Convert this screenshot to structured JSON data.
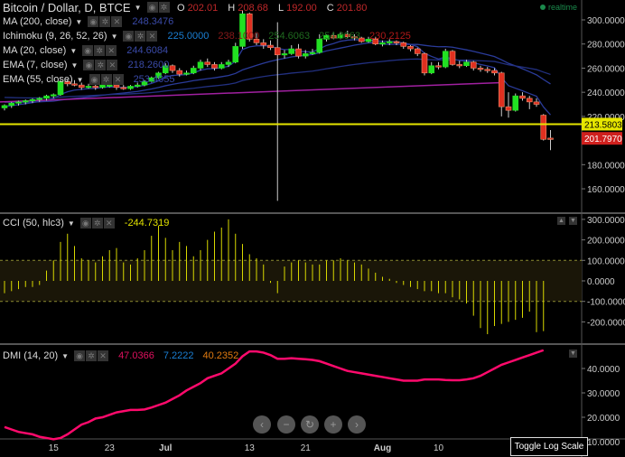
{
  "header": {
    "title": "Bitcoin / Dollar, D, BTCE",
    "ohlc": {
      "o_label": "O",
      "o": "202.01",
      "h_label": "H",
      "h": "208.68",
      "l_label": "L",
      "l": "192.00",
      "c_label": "C",
      "c": "201.80"
    },
    "realtime": "realtime"
  },
  "indicators": [
    {
      "name": "MA (200, close)",
      "values": [
        "248.3476"
      ],
      "colors": [
        "#3a4aa8"
      ]
    },
    {
      "name": "Ichimoku (9, 26, 52, 26)",
      "values": [
        "225.0000",
        "238.1000",
        "254.6063",
        "254.6063",
        "230.2125"
      ],
      "colors": [
        "#1a7fd4",
        "#8b1a1a",
        "#1f6b1f",
        "#1f6b1f",
        "#b01818"
      ]
    },
    {
      "name": "MA (20, close)",
      "values": [
        "244.6084"
      ],
      "colors": [
        "#3a4aa8"
      ]
    },
    {
      "name": "EMA (7, close)",
      "values": [
        "218.2600"
      ],
      "colors": [
        "#3a4aa8"
      ]
    },
    {
      "name": "EMA (55, close)",
      "values": [
        "253.4055"
      ],
      "colors": [
        "#3a4aa8"
      ]
    }
  ],
  "cci": {
    "name": "CCI (50, hlc3)",
    "value": "-244.7319",
    "color": "#e0e000"
  },
  "dmi": {
    "name": "DMI (14, 20)",
    "values": [
      "47.0366",
      "7.2222",
      "40.2352"
    ],
    "colors": [
      "#e0105f",
      "#1a7fd4",
      "#e07a10"
    ]
  },
  "price_labels": {
    "last_line": "213.5803",
    "last_price": "201.7970",
    "line_color": "#e6e600",
    "price_color": "#d0201e"
  },
  "toolbar": {
    "tooltip": "Toggle Log Scale",
    "buttons": [
      "scroll-left",
      "zoom-out",
      "reset",
      "zoom-in",
      "scroll-right"
    ],
    "glyphs": [
      "‹",
      "−",
      "↻",
      "+",
      "›"
    ]
  },
  "chart_data": [
    {
      "type": "candlestick",
      "title": "Bitcoin / Dollar, D, BTCE",
      "yaxis_ticks": [
        "300.0000",
        "280.0000",
        "260.0000",
        "240.0000",
        "220.0000",
        "180.0000",
        "160.0000"
      ],
      "ylim": [
        150,
        310
      ],
      "xaxis_ticks": [
        "15",
        "23",
        "Jul",
        "13",
        "21",
        "Aug",
        "10"
      ],
      "xaxis_tick_index": [
        7,
        15,
        23,
        35,
        43,
        54,
        62
      ],
      "ma200": [
        232,
        248
      ],
      "candles": [
        [
          227,
          230,
          225,
          229
        ],
        [
          229,
          232,
          227,
          231
        ],
        [
          231,
          233,
          229,
          232
        ],
        [
          232,
          234,
          230,
          233
        ],
        [
          233,
          235,
          231,
          234
        ],
        [
          234,
          236,
          232,
          235
        ],
        [
          235,
          238,
          233,
          237
        ],
        [
          237,
          239,
          235,
          238
        ],
        [
          238,
          250,
          237,
          249
        ],
        [
          249,
          251,
          245,
          247
        ],
        [
          247,
          250,
          245,
          246
        ],
        [
          246,
          248,
          242,
          244
        ],
        [
          244,
          247,
          243,
          245
        ],
        [
          245,
          247,
          242,
          244
        ],
        [
          244,
          247,
          243,
          246
        ],
        [
          246,
          248,
          244,
          246
        ],
        [
          246,
          247,
          242,
          244
        ],
        [
          244,
          246,
          242,
          243
        ],
        [
          243,
          246,
          242,
          245
        ],
        [
          245,
          248,
          244,
          246
        ],
        [
          246,
          250,
          245,
          249
        ],
        [
          249,
          253,
          248,
          252
        ],
        [
          252,
          257,
          251,
          256
        ],
        [
          256,
          264,
          255,
          262
        ],
        [
          262,
          263,
          256,
          258
        ],
        [
          258,
          260,
          253,
          255
        ],
        [
          255,
          258,
          254,
          256
        ],
        [
          256,
          262,
          255,
          260
        ],
        [
          260,
          267,
          258,
          265
        ],
        [
          265,
          268,
          261,
          263
        ],
        [
          263,
          265,
          258,
          260
        ],
        [
          260,
          265,
          259,
          263
        ],
        [
          263,
          267,
          261,
          265
        ],
        [
          265,
          281,
          264,
          278
        ],
        [
          278,
          308,
          276,
          305
        ],
        [
          305,
          306,
          282,
          284
        ],
        [
          284,
          289,
          279,
          281
        ],
        [
          281,
          284,
          276,
          279
        ],
        [
          279,
          283,
          275,
          277
        ],
        [
          277,
          298,
          150,
          271
        ],
        [
          271,
          275,
          268,
          272
        ],
        [
          272,
          279,
          271,
          276
        ],
        [
          276,
          280,
          268,
          270
        ],
        [
          270,
          275,
          268,
          272
        ],
        [
          272,
          276,
          271,
          273
        ],
        [
          273,
          288,
          272,
          284
        ],
        [
          284,
          288,
          282,
          287
        ],
        [
          287,
          290,
          284,
          285
        ],
        [
          285,
          290,
          284,
          288
        ],
        [
          288,
          291,
          285,
          286
        ],
        [
          286,
          288,
          283,
          285
        ],
        [
          285,
          286,
          281,
          282
        ],
        [
          282,
          286,
          281,
          284
        ],
        [
          284,
          286,
          279,
          280
        ],
        [
          280,
          283,
          278,
          281
        ],
        [
          281,
          284,
          279,
          282
        ],
        [
          282,
          283,
          279,
          281
        ],
        [
          281,
          282,
          276,
          278
        ],
        [
          278,
          279,
          274,
          276
        ],
        [
          276,
          277,
          270,
          272
        ],
        [
          272,
          273,
          254,
          256
        ],
        [
          256,
          265,
          255,
          262
        ],
        [
          262,
          265,
          259,
          261
        ],
        [
          261,
          276,
          260,
          274
        ],
        [
          274,
          275,
          262,
          263
        ],
        [
          263,
          266,
          260,
          262
        ],
        [
          262,
          267,
          261,
          265
        ],
        [
          265,
          266,
          258,
          260
        ],
        [
          260,
          262,
          257,
          259
        ],
        [
          259,
          261,
          256,
          258
        ],
        [
          258,
          260,
          254,
          256
        ],
        [
          256,
          257,
          220,
          228
        ],
        [
          228,
          240,
          219,
          225
        ],
        [
          225,
          239,
          224,
          237
        ],
        [
          237,
          240,
          233,
          235
        ],
        [
          235,
          237,
          226,
          232
        ],
        [
          232,
          235,
          228,
          230
        ],
        [
          221,
          222,
          200,
          201
        ],
        [
          202.01,
          208.68,
          192.0,
          201.8
        ]
      ]
    },
    {
      "type": "bar",
      "title": "CCI (50, hlc3)",
      "yaxis_ticks": [
        "300.0000",
        "200.0000",
        "100.0000",
        "0.0000",
        "-100.0000",
        "-200.0000"
      ],
      "ylim": [
        -300,
        310
      ],
      "bands": [
        100,
        -100
      ],
      "values": [
        -60,
        -50,
        -40,
        -30,
        -30,
        -20,
        50,
        100,
        190,
        230,
        170,
        110,
        100,
        90,
        120,
        150,
        160,
        90,
        80,
        110,
        150,
        220,
        270,
        210,
        150,
        190,
        170,
        120,
        150,
        200,
        240,
        260,
        300,
        230,
        180,
        130,
        110,
        80,
        -10,
        -60,
        70,
        90,
        100,
        90,
        80,
        80,
        100,
        100,
        110,
        100,
        90,
        80,
        60,
        40,
        20,
        10,
        -10,
        -20,
        -30,
        -40,
        -50,
        -50,
        -60,
        -60,
        -80,
        -90,
        -110,
        -170,
        -230,
        -260,
        -220,
        -210,
        -200,
        -190,
        -180,
        -150,
        -250,
        -245
      ]
    },
    {
      "type": "line",
      "title": "DMI (14, 20)",
      "yaxis_ticks": [
        "40.0000",
        "30.0000",
        "20.0000",
        "10.0000"
      ],
      "ylim": [
        8,
        49
      ],
      "series": [
        {
          "values": [
            16,
            15,
            14,
            13.5,
            13,
            12,
            11.5,
            11,
            11.5,
            13,
            15,
            17,
            18,
            19.5,
            20,
            21,
            22,
            22.5,
            23,
            23,
            23.2,
            24,
            25,
            26,
            27.5,
            29,
            31,
            32.5,
            34,
            36,
            37,
            38,
            40,
            42,
            45,
            47,
            47,
            46.5,
            45.5,
            44,
            44,
            44.2,
            44,
            43.8,
            43.5,
            43,
            42,
            41,
            40,
            39,
            38.5,
            38,
            37.5,
            37,
            36.5,
            36,
            35.5,
            35,
            35,
            35,
            35.5,
            35.5,
            35.5,
            35.3,
            35.2,
            35.2,
            35.5,
            36,
            37,
            38.5,
            40,
            41.5,
            42.5,
            43.5,
            44.5,
            45.5,
            46.5,
            47.5
          ]
        }
      ]
    }
  ]
}
